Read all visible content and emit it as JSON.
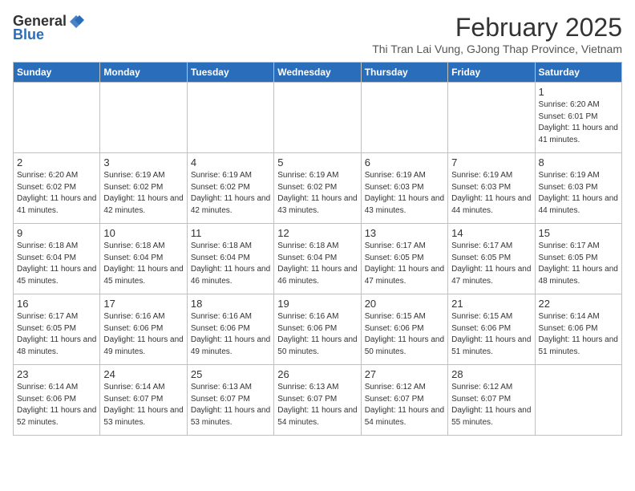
{
  "header": {
    "logo_general": "General",
    "logo_blue": "Blue",
    "month_title": "February 2025",
    "subtitle": "Thi Tran Lai Vung, GJong Thap Province, Vietnam"
  },
  "weekdays": [
    "Sunday",
    "Monday",
    "Tuesday",
    "Wednesday",
    "Thursday",
    "Friday",
    "Saturday"
  ],
  "weeks": [
    [
      {
        "day": "",
        "info": ""
      },
      {
        "day": "",
        "info": ""
      },
      {
        "day": "",
        "info": ""
      },
      {
        "day": "",
        "info": ""
      },
      {
        "day": "",
        "info": ""
      },
      {
        "day": "",
        "info": ""
      },
      {
        "day": "1",
        "info": "Sunrise: 6:20 AM\nSunset: 6:01 PM\nDaylight: 11 hours and 41 minutes."
      }
    ],
    [
      {
        "day": "2",
        "info": "Sunrise: 6:20 AM\nSunset: 6:02 PM\nDaylight: 11 hours and 41 minutes."
      },
      {
        "day": "3",
        "info": "Sunrise: 6:19 AM\nSunset: 6:02 PM\nDaylight: 11 hours and 42 minutes."
      },
      {
        "day": "4",
        "info": "Sunrise: 6:19 AM\nSunset: 6:02 PM\nDaylight: 11 hours and 42 minutes."
      },
      {
        "day": "5",
        "info": "Sunrise: 6:19 AM\nSunset: 6:02 PM\nDaylight: 11 hours and 43 minutes."
      },
      {
        "day": "6",
        "info": "Sunrise: 6:19 AM\nSunset: 6:03 PM\nDaylight: 11 hours and 43 minutes."
      },
      {
        "day": "7",
        "info": "Sunrise: 6:19 AM\nSunset: 6:03 PM\nDaylight: 11 hours and 44 minutes."
      },
      {
        "day": "8",
        "info": "Sunrise: 6:19 AM\nSunset: 6:03 PM\nDaylight: 11 hours and 44 minutes."
      }
    ],
    [
      {
        "day": "9",
        "info": "Sunrise: 6:18 AM\nSunset: 6:04 PM\nDaylight: 11 hours and 45 minutes."
      },
      {
        "day": "10",
        "info": "Sunrise: 6:18 AM\nSunset: 6:04 PM\nDaylight: 11 hours and 45 minutes."
      },
      {
        "day": "11",
        "info": "Sunrise: 6:18 AM\nSunset: 6:04 PM\nDaylight: 11 hours and 46 minutes."
      },
      {
        "day": "12",
        "info": "Sunrise: 6:18 AM\nSunset: 6:04 PM\nDaylight: 11 hours and 46 minutes."
      },
      {
        "day": "13",
        "info": "Sunrise: 6:17 AM\nSunset: 6:05 PM\nDaylight: 11 hours and 47 minutes."
      },
      {
        "day": "14",
        "info": "Sunrise: 6:17 AM\nSunset: 6:05 PM\nDaylight: 11 hours and 47 minutes."
      },
      {
        "day": "15",
        "info": "Sunrise: 6:17 AM\nSunset: 6:05 PM\nDaylight: 11 hours and 48 minutes."
      }
    ],
    [
      {
        "day": "16",
        "info": "Sunrise: 6:17 AM\nSunset: 6:05 PM\nDaylight: 11 hours and 48 minutes."
      },
      {
        "day": "17",
        "info": "Sunrise: 6:16 AM\nSunset: 6:06 PM\nDaylight: 11 hours and 49 minutes."
      },
      {
        "day": "18",
        "info": "Sunrise: 6:16 AM\nSunset: 6:06 PM\nDaylight: 11 hours and 49 minutes."
      },
      {
        "day": "19",
        "info": "Sunrise: 6:16 AM\nSunset: 6:06 PM\nDaylight: 11 hours and 50 minutes."
      },
      {
        "day": "20",
        "info": "Sunrise: 6:15 AM\nSunset: 6:06 PM\nDaylight: 11 hours and 50 minutes."
      },
      {
        "day": "21",
        "info": "Sunrise: 6:15 AM\nSunset: 6:06 PM\nDaylight: 11 hours and 51 minutes."
      },
      {
        "day": "22",
        "info": "Sunrise: 6:14 AM\nSunset: 6:06 PM\nDaylight: 11 hours and 51 minutes."
      }
    ],
    [
      {
        "day": "23",
        "info": "Sunrise: 6:14 AM\nSunset: 6:06 PM\nDaylight: 11 hours and 52 minutes."
      },
      {
        "day": "24",
        "info": "Sunrise: 6:14 AM\nSunset: 6:07 PM\nDaylight: 11 hours and 53 minutes."
      },
      {
        "day": "25",
        "info": "Sunrise: 6:13 AM\nSunset: 6:07 PM\nDaylight: 11 hours and 53 minutes."
      },
      {
        "day": "26",
        "info": "Sunrise: 6:13 AM\nSunset: 6:07 PM\nDaylight: 11 hours and 54 minutes."
      },
      {
        "day": "27",
        "info": "Sunrise: 6:12 AM\nSunset: 6:07 PM\nDaylight: 11 hours and 54 minutes."
      },
      {
        "day": "28",
        "info": "Sunrise: 6:12 AM\nSunset: 6:07 PM\nDaylight: 11 hours and 55 minutes."
      },
      {
        "day": "",
        "info": ""
      }
    ]
  ]
}
